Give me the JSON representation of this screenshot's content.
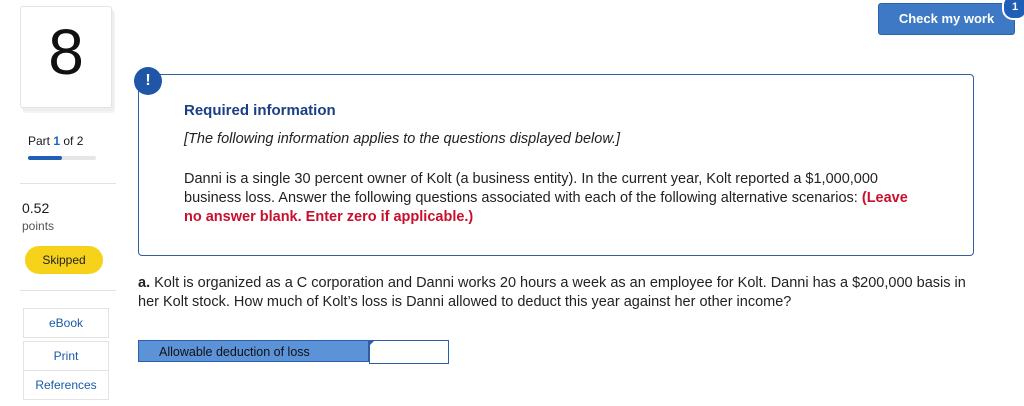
{
  "question_number": "8",
  "part": {
    "prefix": "Part ",
    "current": "1",
    "suffix": " of 2",
    "progress": 0.5
  },
  "points": {
    "value": "0.52",
    "label": "points"
  },
  "status_badge": "Skipped",
  "resources": {
    "ebook": "eBook",
    "print": "Print",
    "references": "References"
  },
  "check_button": {
    "label": "Check my work",
    "badge": "1"
  },
  "required": {
    "icon": "!",
    "title": "Required information",
    "subtitle": "[The following information applies to the questions displayed below.]",
    "body": "Danni is a single 30 percent owner of Kolt (a business entity). In the current year, Kolt reported a $1,000,000 business loss. Answer the following questions associated with each of the following alternative scenarios: ",
    "emphasis": "(Leave no answer blank. Enter zero if applicable.)"
  },
  "question": {
    "letter": "a.",
    "text": " Kolt is organized as a C corporation and Danni works 20 hours a week as an employee for Kolt. Danni has a $200,000 basis in her Kolt stock. How much of Kolt’s loss is Danni allowed to deduct this year against her other income?"
  },
  "answer": {
    "label": "Allowable deduction of loss",
    "value": ""
  },
  "colors": {
    "accent": "#1f5fb5",
    "skipped": "#f6d21a",
    "emphasis": "#c8102e",
    "answer_label_bg": "#5b92d8"
  }
}
